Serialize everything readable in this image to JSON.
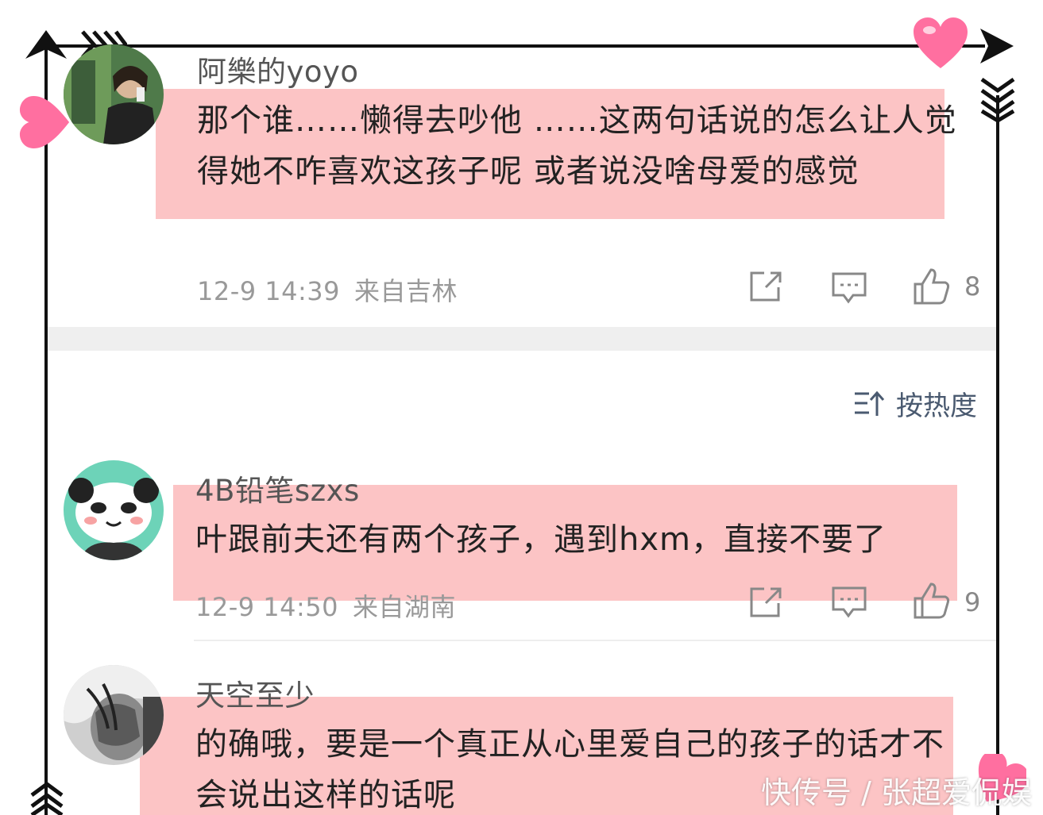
{
  "comments": [
    {
      "username": "阿樂的yoyo",
      "text": "那个谁……懒得去吵他 ……这两句话说的怎么让人觉得她不咋喜欢这孩子呢 或者说没啥母爱的感觉",
      "date": "12-9 14:39",
      "location": "来自吉林",
      "likes": "8"
    },
    {
      "username": "4B铅笔szxs",
      "text": "叶跟前夫还有两个孩子，遇到hxm，直接不要了",
      "date": "12-9 14:50",
      "location": "来自湖南",
      "likes": "9"
    },
    {
      "username": "天空至少",
      "text": "的确哦，要是一个真正从心里爱自己的孩子的话才不会说出这样的话呢"
    }
  ],
  "sort_label": "按热度",
  "watermark": "快传号 / 张超爱侃娱",
  "colors": {
    "highlight": "#fcc4c5",
    "heart": "#ff6fa0",
    "frame": "#111111",
    "sort": "#4a5a70"
  },
  "icons": [
    "share-icon",
    "comment-icon",
    "like-icon",
    "sort-icon",
    "heart-icon",
    "arrow-icon"
  ]
}
